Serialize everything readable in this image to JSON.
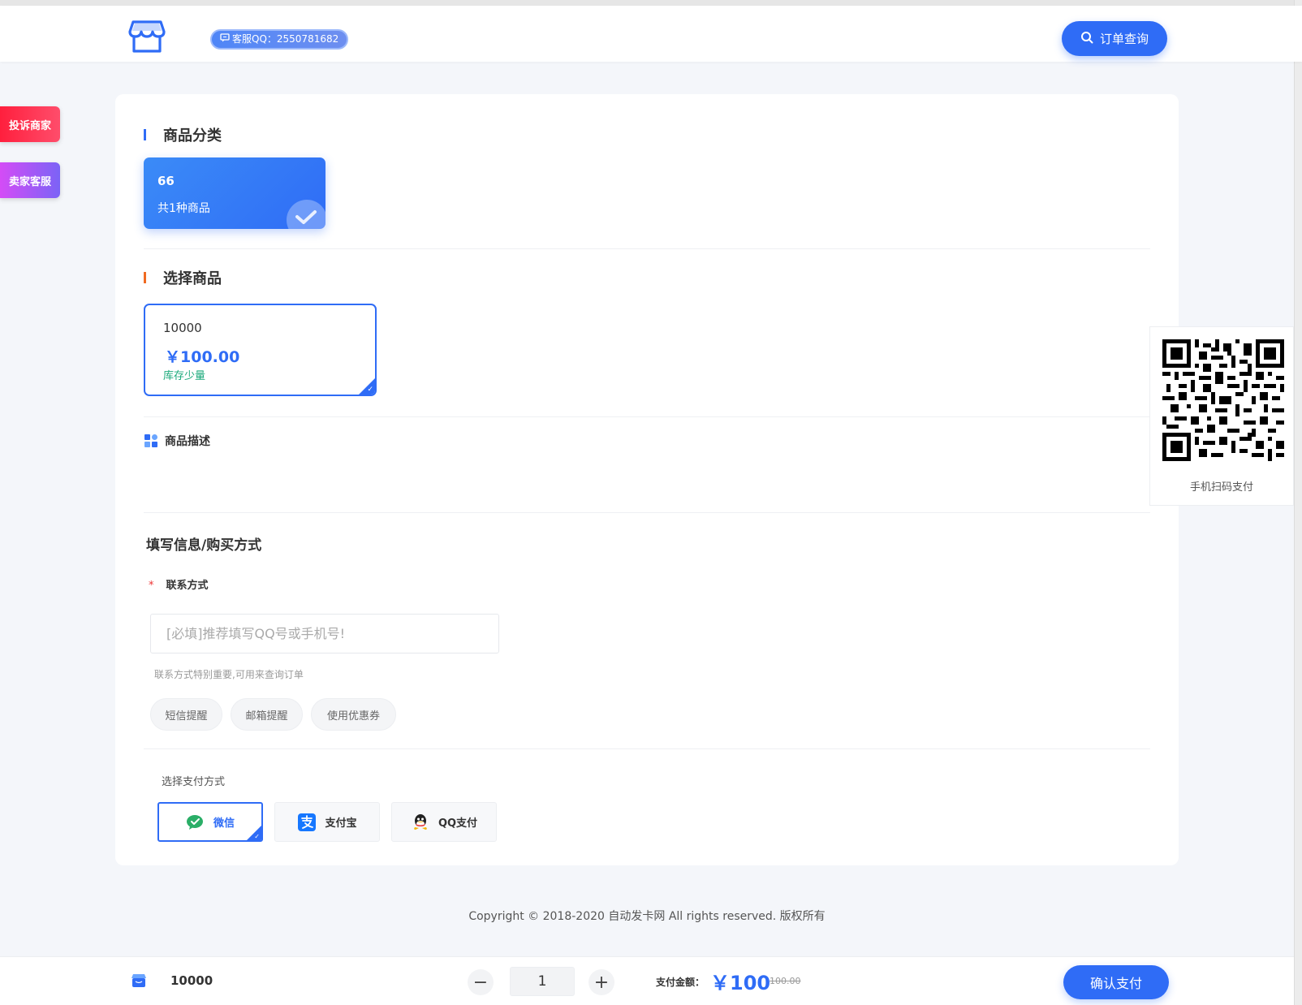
{
  "header": {
    "qq_label": "客服QQ：2550781682",
    "order_query": "订单查询"
  },
  "sidebar": {
    "complain": "投诉商家",
    "service": "卖家客服"
  },
  "category": {
    "title": "商品分类",
    "items": [
      {
        "name": "66",
        "count": "共1种商品"
      }
    ]
  },
  "products": {
    "title": "选择商品",
    "items": [
      {
        "name": "10000",
        "price": "￥100.00",
        "stock": "库存少量"
      }
    ]
  },
  "description": {
    "title": "商品描述"
  },
  "form": {
    "title": "填写信息/购买方式",
    "contact_label": "联系方式",
    "required_mark": "*",
    "contact_placeholder": "[必填]推荐填写QQ号或手机号!",
    "help": "联系方式特别重要,可用来查询订单",
    "options": [
      "短信提醒",
      "邮箱提醒",
      "使用优惠券"
    ]
  },
  "payment": {
    "title": "选择支付方式",
    "methods": [
      {
        "name": "微信",
        "icon": "wechat-icon",
        "color": "#2aae67"
      },
      {
        "name": "支付宝",
        "icon": "alipay-icon",
        "color": "#1677ff"
      },
      {
        "name": "QQ支付",
        "icon": "qq-icon",
        "color": "#222222"
      }
    ],
    "selected": "微信"
  },
  "qr": {
    "caption": "手机扫码支付"
  },
  "copyright": "Copyright © 2018-2020 自动发卡网 All rights reserved. 版权所有",
  "footer": {
    "product": "10000",
    "quantity": "1",
    "amount_label": "支付金额：",
    "amount": "￥100",
    "original": "100.00",
    "confirm": "确认支付"
  },
  "colors": {
    "accent": "#2f6cf6",
    "stock": "#1aa97a",
    "complain": "#ff1f3d",
    "service": "#b156f6"
  }
}
